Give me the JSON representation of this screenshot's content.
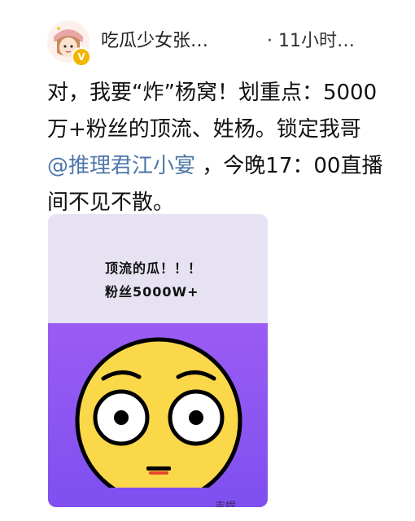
{
  "post": {
    "username": "吃瓜少女张…",
    "timestamp": "· 11小时…",
    "text_before_mention": "对，我要“炸”杨窝！划重点：5000万+粉丝的顶流、姓杨。锁定我哥 ",
    "mention": "@推理君江小宴",
    "text_after_mention": " ，今晚17：00直播间不见不散。"
  },
  "card": {
    "line1": "顶流的瓜！！！",
    "line2": "粉丝5000W+",
    "watermark": "吉娱"
  },
  "colors": {
    "mention": "#4e76a9",
    "card_top": "#e7e2f2",
    "card_bottom": "#8a55f2",
    "verified_badge": "#f5b400",
    "emoji_face": "#fbd84a"
  },
  "icons": [
    "avatar",
    "verified-badge-icon",
    "flushed-face-emoji"
  ]
}
